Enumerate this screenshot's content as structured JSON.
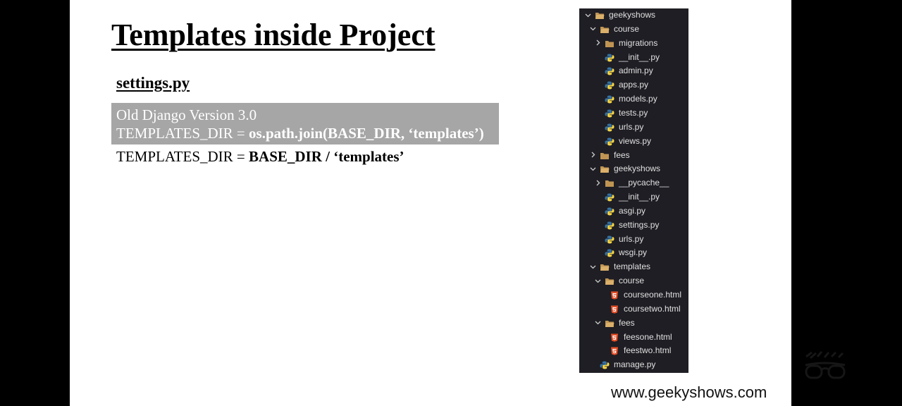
{
  "slide": {
    "title": "Templates inside Project",
    "subtitle": "settings.py",
    "old_block": {
      "line1": "Old Django Version 3.0",
      "line2_prefix": "TEMPLATES_DIR = ",
      "line2_bold": "os.path.join(BASE_DIR, ‘templates’)"
    },
    "new_line": {
      "prefix": "TEMPLATES_DIR = ",
      "bold": "BASE_DIR / ‘templates’"
    },
    "watermark": "www.geekyshows.com"
  },
  "explorer": {
    "colors": {
      "background": "#1e1e24",
      "folder": "#c09553",
      "python_blue": "#3572A5",
      "python_yellow": "#f5d547",
      "html": "#e44d26"
    },
    "items": [
      {
        "label": "geekyshows",
        "type": "folder",
        "chevron": "down",
        "depth": 0
      },
      {
        "label": "course",
        "type": "folder",
        "chevron": "down",
        "depth": 1
      },
      {
        "label": "migrations",
        "type": "folder",
        "chevron": "right",
        "depth": 2
      },
      {
        "label": "__init__.py",
        "type": "python",
        "depth": 2
      },
      {
        "label": "admin.py",
        "type": "python",
        "depth": 2
      },
      {
        "label": "apps.py",
        "type": "python",
        "depth": 2
      },
      {
        "label": "models.py",
        "type": "python",
        "depth": 2
      },
      {
        "label": "tests.py",
        "type": "python",
        "depth": 2
      },
      {
        "label": "urls.py",
        "type": "python",
        "depth": 2
      },
      {
        "label": "views.py",
        "type": "python",
        "depth": 2
      },
      {
        "label": "fees",
        "type": "folder",
        "chevron": "right",
        "depth": 1
      },
      {
        "label": "geekyshows",
        "type": "folder",
        "chevron": "down",
        "depth": 1
      },
      {
        "label": "__pycache__",
        "type": "folder",
        "chevron": "right",
        "depth": 2
      },
      {
        "label": "__init__.py",
        "type": "python",
        "depth": 2
      },
      {
        "label": "asgi.py",
        "type": "python",
        "depth": 2
      },
      {
        "label": "settings.py",
        "type": "python",
        "depth": 2
      },
      {
        "label": "urls.py",
        "type": "python",
        "depth": 2
      },
      {
        "label": "wsgi.py",
        "type": "python",
        "depth": 2
      },
      {
        "label": "templates",
        "type": "folder",
        "chevron": "down",
        "depth": 1
      },
      {
        "label": "course",
        "type": "folder",
        "chevron": "down",
        "depth": 2
      },
      {
        "label": "courseone.html",
        "type": "html",
        "depth": 3
      },
      {
        "label": "coursetwo.html",
        "type": "html",
        "depth": 3
      },
      {
        "label": "fees",
        "type": "folder",
        "chevron": "down",
        "depth": 2
      },
      {
        "label": "feesone.html",
        "type": "html",
        "depth": 3
      },
      {
        "label": "feestwo.html",
        "type": "html",
        "depth": 3
      },
      {
        "label": "manage.py",
        "type": "python",
        "depth": 1
      }
    ]
  }
}
